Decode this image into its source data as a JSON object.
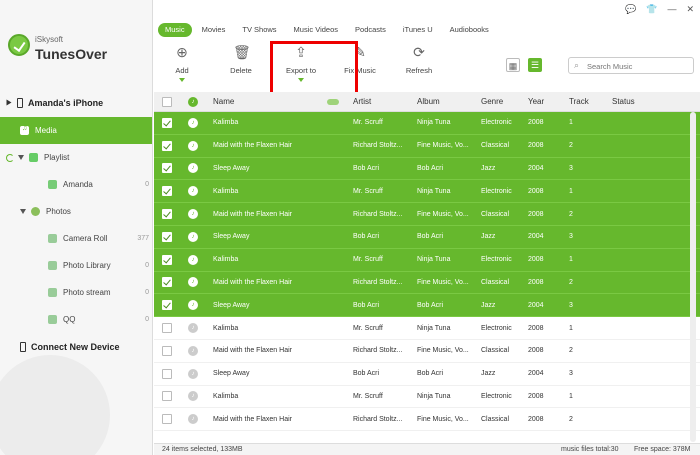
{
  "brand": {
    "small": "iSkysoft",
    "big": "TunesOver"
  },
  "window_controls": [
    "💬",
    "👕",
    "—",
    "✕"
  ],
  "sidebar": {
    "device": "Amanda's iPhone",
    "items": [
      {
        "label": "Media",
        "count": ""
      },
      {
        "label": "Playlist",
        "count": ""
      },
      {
        "label": "Amanda",
        "count": "0"
      },
      {
        "label": "Photos",
        "count": ""
      },
      {
        "label": "Camera Roll",
        "count": "377"
      },
      {
        "label": "Photo Library",
        "count": "0"
      },
      {
        "label": "Photo stream",
        "count": "0"
      },
      {
        "label": "QQ",
        "count": "0"
      }
    ],
    "connect": "Connect New Device"
  },
  "tabs": [
    "Music",
    "Movies",
    "TV Shows",
    "Music Videos",
    "Podcasts",
    "iTunes U",
    "Audiobooks"
  ],
  "toolbar": {
    "add": "Add",
    "delete": "Delete",
    "export": "Export to",
    "fix": "Fix Music",
    "refresh": "Refresh"
  },
  "search": {
    "placeholder": "Search Music"
  },
  "table": {
    "headers": {
      "name": "Name",
      "artist": "Artist",
      "album": "Album",
      "genre": "Genre",
      "year": "Year",
      "track": "Track",
      "status": "Status"
    },
    "rows": [
      {
        "name": "Kalimba",
        "artist": "Mr. Scruff",
        "album": "Ninja Tuna",
        "genre": "Electronic",
        "year": "2008",
        "track": "1",
        "selected": true
      },
      {
        "name": "Maid with the Flaxen Hair",
        "artist": "Richard Stoltz...",
        "album": "Fine Music, Vo...",
        "genre": "Classical",
        "year": "2008",
        "track": "2",
        "selected": true
      },
      {
        "name": "Sleep Away",
        "artist": "Bob Acri",
        "album": "Bob Acri",
        "genre": "Jazz",
        "year": "2004",
        "track": "3",
        "selected": true
      },
      {
        "name": "Kalimba",
        "artist": "Mr. Scruff",
        "album": "Ninja Tuna",
        "genre": "Electronic",
        "year": "2008",
        "track": "1",
        "selected": true
      },
      {
        "name": "Maid with the Flaxen Hair",
        "artist": "Richard Stoltz...",
        "album": "Fine Music, Vo...",
        "genre": "Classical",
        "year": "2008",
        "track": "2",
        "selected": true
      },
      {
        "name": "Sleep Away",
        "artist": "Bob Acri",
        "album": "Bob Acri",
        "genre": "Jazz",
        "year": "2004",
        "track": "3",
        "selected": true
      },
      {
        "name": "Kalimba",
        "artist": "Mr. Scruff",
        "album": "Ninja Tuna",
        "genre": "Electronic",
        "year": "2008",
        "track": "1",
        "selected": true
      },
      {
        "name": "Maid with the Flaxen Hair",
        "artist": "Richard Stoltz...",
        "album": "Fine Music, Vo...",
        "genre": "Classical",
        "year": "2008",
        "track": "2",
        "selected": true
      },
      {
        "name": "Sleep Away",
        "artist": "Bob Acri",
        "album": "Bob Acri",
        "genre": "Jazz",
        "year": "2004",
        "track": "3",
        "selected": true
      },
      {
        "name": "Kalimba",
        "artist": "Mr. Scruff",
        "album": "Ninja Tuna",
        "genre": "Electronic",
        "year": "2008",
        "track": "1",
        "selected": false
      },
      {
        "name": "Maid with the Flaxen Hair",
        "artist": "Richard Stoltz...",
        "album": "Fine Music, Vo...",
        "genre": "Classical",
        "year": "2008",
        "track": "2",
        "selected": false
      },
      {
        "name": "Sleep Away",
        "artist": "Bob Acri",
        "album": "Bob Acri",
        "genre": "Jazz",
        "year": "2004",
        "track": "3",
        "selected": false
      },
      {
        "name": "Kalimba",
        "artist": "Mr. Scruff",
        "album": "Ninja Tuna",
        "genre": "Electronic",
        "year": "2008",
        "track": "1",
        "selected": false
      },
      {
        "name": "Maid with the Flaxen Hair",
        "artist": "Richard Stoltz...",
        "album": "Fine Music, Vo...",
        "genre": "Classical",
        "year": "2008",
        "track": "2",
        "selected": false
      }
    ]
  },
  "status": {
    "left": "24 items selected, 133MB",
    "total": "music files total:30",
    "free": "Free space: 378M"
  },
  "colors": {
    "accent": "#66b82d",
    "highlight": "#e00000"
  }
}
